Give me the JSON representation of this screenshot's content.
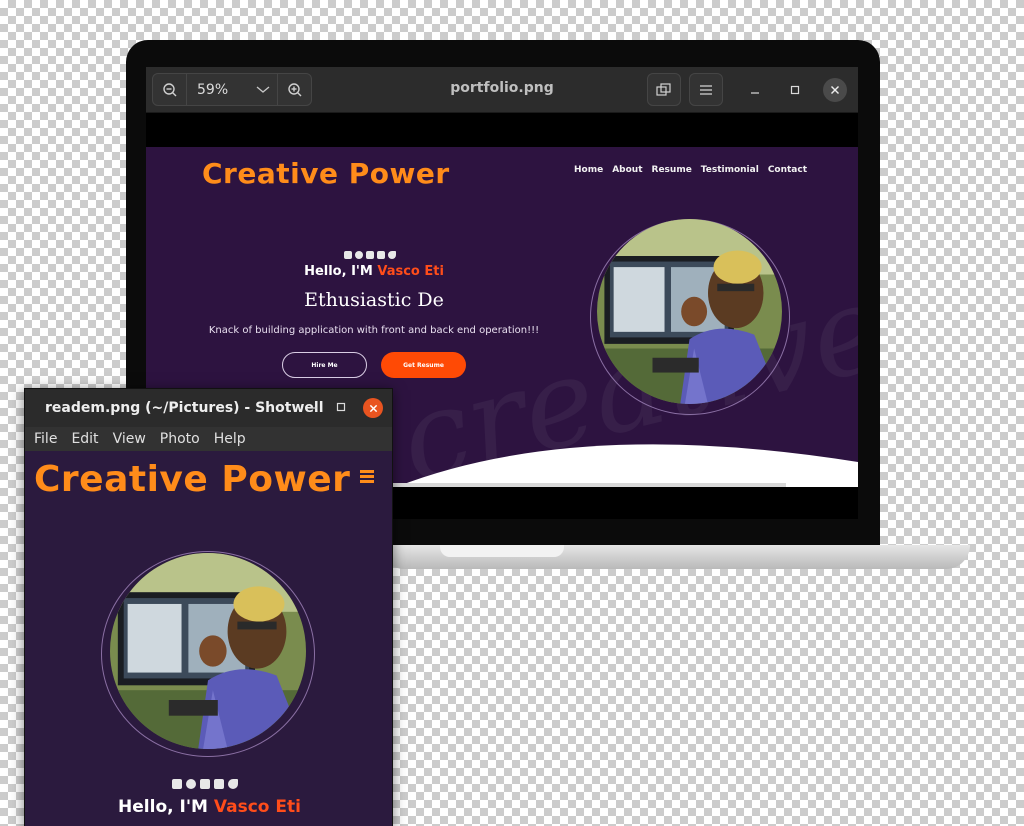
{
  "viewer": {
    "title": "portfolio.png",
    "zoom": "59%"
  },
  "portfolio": {
    "logo": "Creative Power",
    "nav": [
      "Home",
      "About",
      "Resume",
      "Testimonial",
      "Contact"
    ],
    "social_icons": [
      "facebook-icon",
      "whatsapp-icon",
      "instagram-icon",
      "youtube-icon",
      "twitter-icon"
    ],
    "greeting_prefix": "Hello, I'M ",
    "name": "Vasco Eti",
    "role": "Ethusiastic De",
    "description": "Knack of building application with front and back end operation!!!",
    "hire_button": "Hire Me",
    "resume_button": "Get Resume"
  },
  "shotwell": {
    "title": "readem.png (~/Pictures) - Shotwell",
    "menu": [
      "File",
      "Edit",
      "View",
      "Photo",
      "Help"
    ]
  },
  "colors": {
    "page_bg": "#2d1340",
    "logo": "#ff8c1a",
    "accent": "#ff4d1a",
    "resume_button": "#ff4a05",
    "close_button": "#e95420"
  }
}
